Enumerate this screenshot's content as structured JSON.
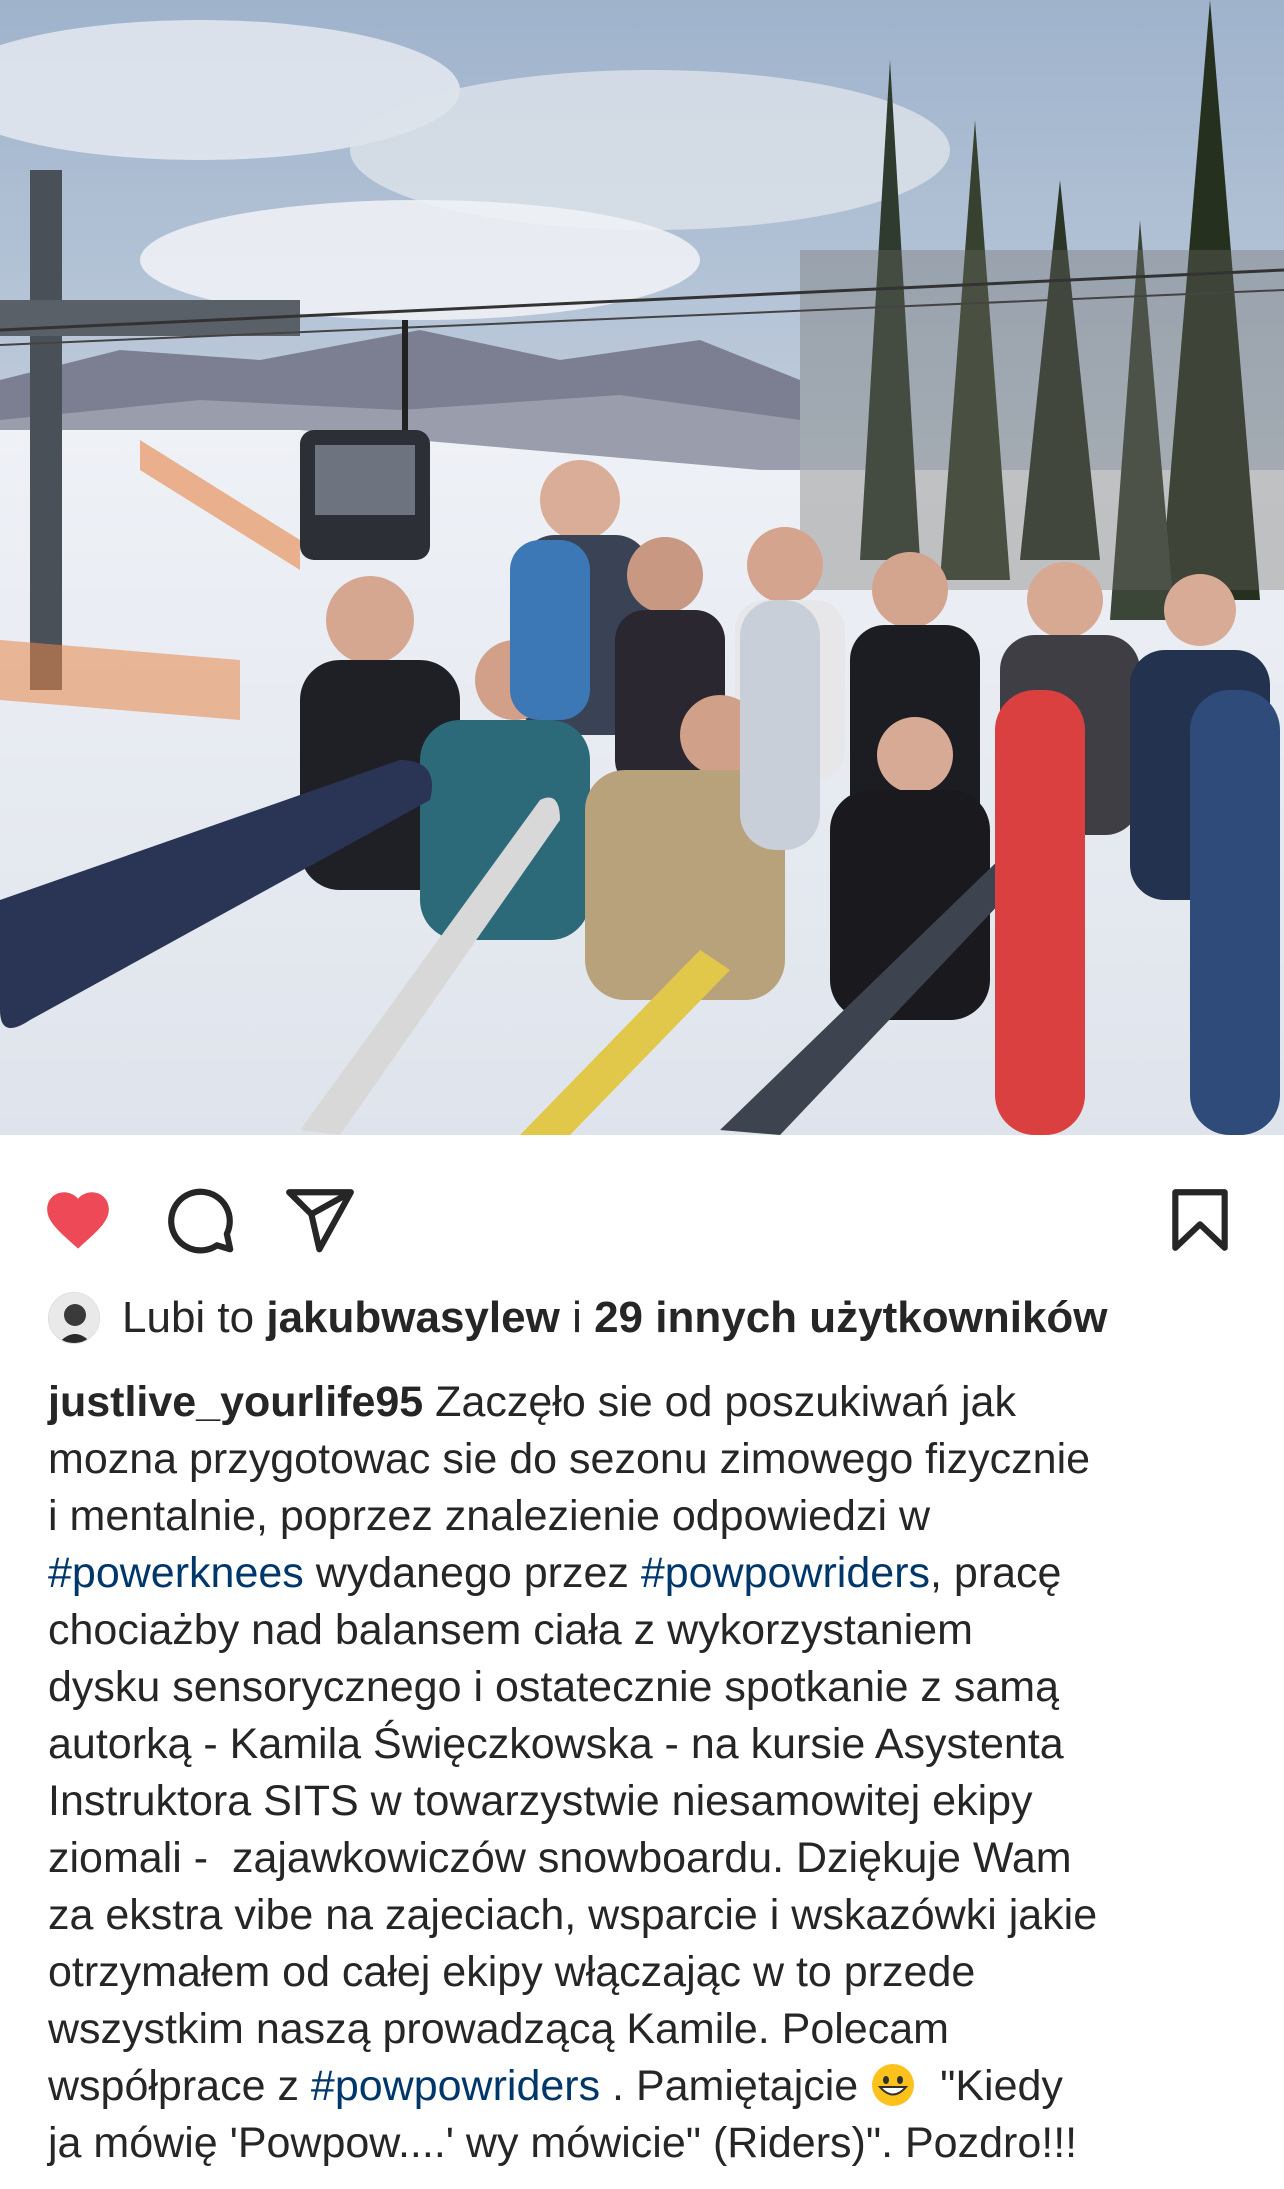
{
  "post": {
    "photo_alt": "",
    "actions": {
      "like_icon": "heart-filled-icon",
      "comment_icon": "comment-bubble-icon",
      "share_icon": "paper-plane-icon",
      "save_icon": "bookmark-icon",
      "like_color": "#ed4956"
    },
    "likes": {
      "prefix": "Lubi to",
      "user": "jakubwasylew",
      "connector": "i",
      "others": "29 innych użytkowników"
    },
    "caption": {
      "username": "justlive_yourlife95",
      "lines": [
        " Zaczęło sie od poszukiwań jak",
        "mozna przygotowac sie do sezonu zimowego fizycznie",
        "i mentalnie, poprzez znalezienie odpowiedzi w",
        [
          "#powerknees",
          " wydanego przez ",
          "#powpowriders",
          ", pracę"
        ],
        "chociażby nad balansem ciała z wykorzystaniem",
        "dysku sensorycznego i ostatecznie spotkanie z samą",
        "autorką - Kamila Święczkowska - na kursie Asystenta",
        "Instruktora SITS w towarzystwie niesamowitej ekipy",
        "ziomali -  zajawkowiczów snowboardu. Dziękuje Wam",
        "za ekstra vibe na zajeciach, wsparcie i wskazówki jakie",
        "otrzymałem od całej ekipy włączając w to przede",
        "wszystkim naszą prowadzącą Kamile. Polecam",
        [
          "współprace z ",
          "#powpowriders",
          " . Pamiętajcie ",
          "  \"Kiedy"
        ],
        "ja mówię 'Powpow....' wy mówicie\" (Riders)\". Pozdro!!!"
      ]
    },
    "colors": {
      "hashtag": "#00376b",
      "text": "#262626"
    }
  }
}
